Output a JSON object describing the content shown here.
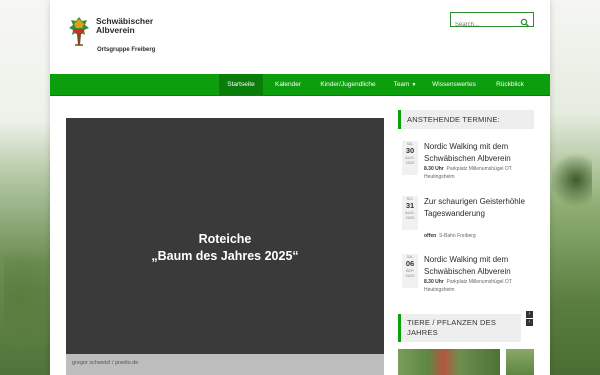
{
  "logo": {
    "line1": "Schwäbischer",
    "line2": "Albverein",
    "subtitle": "Ortsgruppe Freiberg"
  },
  "search": {
    "placeholder": "Search..."
  },
  "nav": {
    "items": [
      {
        "label": "Startseite",
        "active": true
      },
      {
        "label": "Kalender"
      },
      {
        "label": "Kinder/Jugendliche"
      },
      {
        "label": "Team",
        "caret": "chevron-down-icon"
      },
      {
        "label": "Wissenswertes"
      },
      {
        "label": "Rückblick"
      }
    ]
  },
  "slider": {
    "title_line1": "Roteiche",
    "title_line2": "„Baum des Jahres 2025“",
    "credit": "gregor schwetzl / pixelio.de"
  },
  "sidebar": {
    "events_title": "ANSTEHENDE TERMINE:",
    "events": [
      {
        "dow": "SA.",
        "day": "30",
        "month": "AUG.",
        "year": "2025",
        "title": "Nordic Walking mit dem Schwäbischen Albverein",
        "time": "8.30 Uhr",
        "place": "Parkplatz Millenumshügel OT Heutingsheim"
      },
      {
        "dow": "SO.",
        "day": "31",
        "month": "AUG.",
        "year": "2025",
        "title": "Zur schaurigen Geisterhöhle Tageswanderung",
        "time": "offen",
        "place": "S-Bahn Freiberg"
      },
      {
        "dow": "SA.",
        "day": "06",
        "month": "SEP.",
        "year": "2025",
        "title": "Nordic Walking mit dem Schwäbischen Albverein",
        "time": "8.30 Uhr",
        "place": "Parkplatz Millenumshügel OT Heutingsheim"
      }
    ],
    "nature_title": "TIERE / PFLANZEN DES JAHRES"
  },
  "colors": {
    "nav_green": "#0c9e0c",
    "nav_active": "#0a7c0a",
    "slider_bg": "#3a3a3a"
  }
}
